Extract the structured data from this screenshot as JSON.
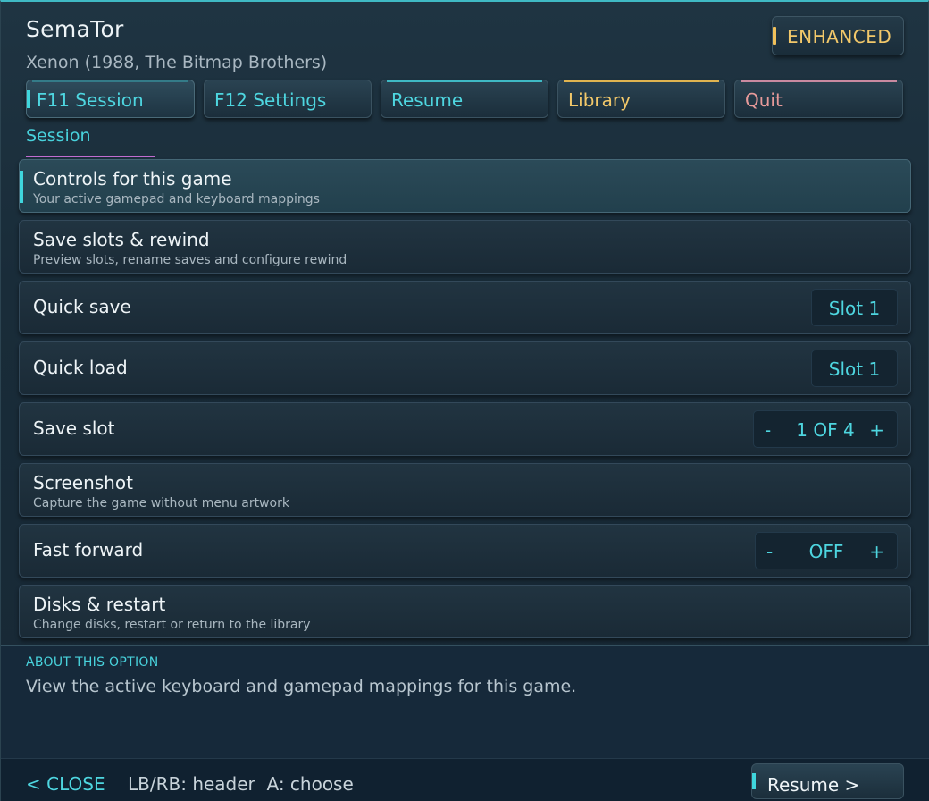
{
  "header": {
    "title": "SemaTor",
    "subtitle": "Xenon (1988, The Bitmap Brothers)",
    "badge": "ENHANCED"
  },
  "tabs": [
    {
      "label": "F11 Session",
      "color": "#4ed6e0",
      "accent": "#3fd6dd",
      "active": true
    },
    {
      "label": "F12 Settings",
      "color": "#4ed6e0",
      "accent": "#2b4350",
      "active": false
    },
    {
      "label": "Resume",
      "color": "#4ed6e0",
      "accent": "#3fb9c4",
      "active": false
    },
    {
      "label": "Library",
      "color": "#f2c86a",
      "accent": "#e0b450",
      "active": false
    },
    {
      "label": "Quit",
      "color": "#e79a9a",
      "accent": "#c98aa0",
      "active": false
    }
  ],
  "section": {
    "label": "Session"
  },
  "rows": [
    {
      "title": "Controls for this game",
      "desc": "Your active gamepad and keyboard mappings"
    },
    {
      "title": "Save slots & rewind",
      "desc": "Preview slots, rename saves and configure rewind"
    },
    {
      "title": "Quick save",
      "value": "Slot 1"
    },
    {
      "title": "Quick load",
      "value": "Slot 1"
    },
    {
      "title": "Save slot",
      "minus": "-",
      "value": "1 OF 4",
      "plus": "+"
    },
    {
      "title": "Screenshot",
      "desc": "Capture the game without menu artwork"
    },
    {
      "title": "Fast forward",
      "minus": "-",
      "value": "OFF",
      "plus": "+"
    },
    {
      "title": "Disks & restart",
      "desc": "Change disks, restart or return to the library"
    }
  ],
  "about": {
    "heading": "ABOUT THIS OPTION",
    "text": "View the active keyboard and gamepad mappings for this game."
  },
  "footer": {
    "close": "< CLOSE",
    "hints": "LB/RB: header  A: choose",
    "resume": "Resume >"
  }
}
